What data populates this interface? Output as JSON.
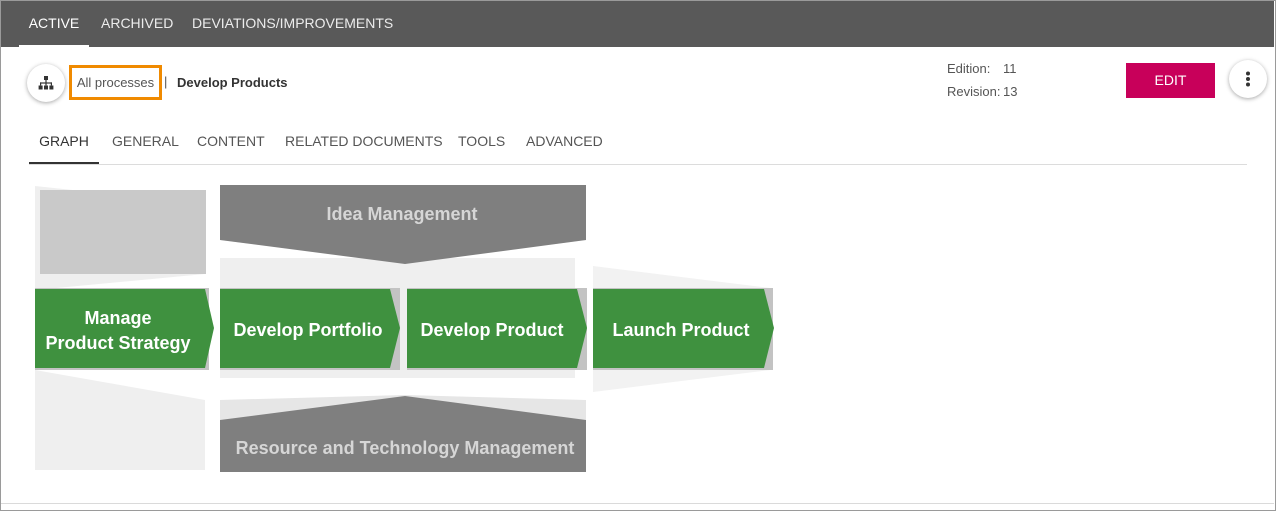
{
  "top_tabs": [
    {
      "label": "ACTIVE",
      "active": true
    },
    {
      "label": "ARCHIVED",
      "active": false
    },
    {
      "label": "DEVIATIONS/IMPROVEMENTS",
      "active": false
    }
  ],
  "breadcrumb": {
    "all_processes": "All processes",
    "separator": "|",
    "current": "Develop Products"
  },
  "meta": {
    "edition_label": "Edition:",
    "edition_value": "11",
    "revision_label": "Revision:",
    "revision_value": "13"
  },
  "actions": {
    "edit_label": "EDIT"
  },
  "sub_tabs": [
    {
      "label": "GRAPH",
      "active": true
    },
    {
      "label": "GENERAL",
      "active": false
    },
    {
      "label": "CONTENT",
      "active": false
    },
    {
      "label": "RELATED DOCUMENTS",
      "active": false
    },
    {
      "label": "TOOLS",
      "active": false
    },
    {
      "label": "ADVANCED",
      "active": false
    }
  ],
  "graph": {
    "top_process": "Idea Management",
    "bottom_process": "Resource and Technology Management",
    "main_chain": [
      {
        "line1": "Manage",
        "line2": "Product Strategy"
      },
      {
        "line1": "Develop Portfolio"
      },
      {
        "line1": "Develop Product"
      },
      {
        "line1": "Launch Product"
      }
    ]
  },
  "colors": {
    "topbar": "#595959",
    "accent": "#c8005a",
    "highlight": "#f08a00",
    "process_green": "#3f913f",
    "support_grey": "#7f7f7f"
  },
  "icons": {
    "hierarchy": "hierarchy-icon",
    "more": "more-vertical-icon"
  }
}
